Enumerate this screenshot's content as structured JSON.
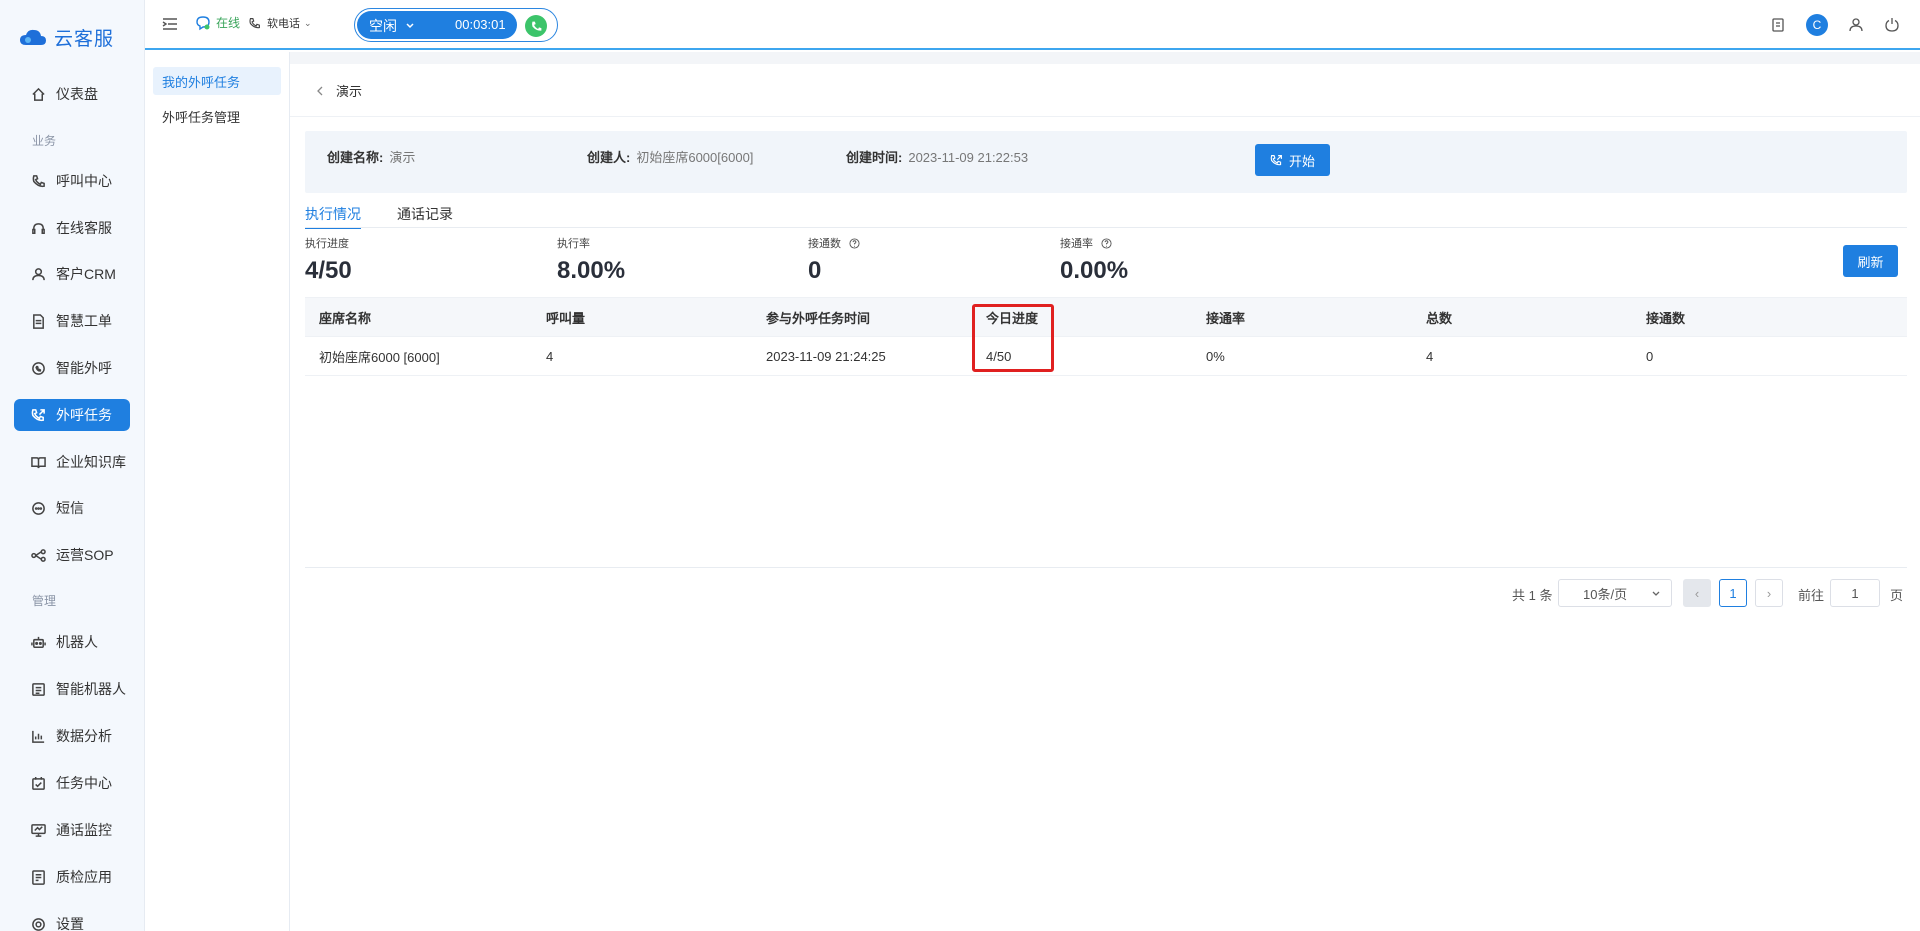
{
  "app": {
    "logo_text": "云客服"
  },
  "sidebar": {
    "items": [
      {
        "label": "仪表盘",
        "icon": "home-icon"
      },
      {
        "label": "呼叫中心",
        "icon": "phone-icon"
      },
      {
        "label": "在线客服",
        "icon": "headset-icon"
      },
      {
        "label": "客户CRM",
        "icon": "user-icon"
      },
      {
        "label": "智慧工单",
        "icon": "document-icon"
      },
      {
        "label": "智能外呼",
        "icon": "chat-phone-icon"
      },
      {
        "label": "外呼任务",
        "icon": "outbound-call-icon"
      },
      {
        "label": "企业知识库",
        "icon": "book-icon"
      },
      {
        "label": "短信",
        "icon": "message-icon"
      },
      {
        "label": "运营SOP",
        "icon": "flow-icon"
      },
      {
        "label": "机器人",
        "icon": "robot-icon"
      },
      {
        "label": "智能机器人",
        "icon": "smart-robot-icon"
      },
      {
        "label": "数据分析",
        "icon": "chart-icon"
      },
      {
        "label": "任务中心",
        "icon": "task-icon"
      },
      {
        "label": "通话监控",
        "icon": "monitor-icon"
      },
      {
        "label": "质检应用",
        "icon": "inspect-icon"
      },
      {
        "label": "设置",
        "icon": "gear-icon"
      }
    ],
    "sections": {
      "business": "业务",
      "manage": "管理"
    }
  },
  "topbar": {
    "online_status": "在线",
    "softphone_label": "软电话",
    "call_state": "空闲",
    "call_timer": "00:03:01",
    "avatar_letter": "C"
  },
  "submenu": {
    "items": [
      {
        "label": "我的外呼任务"
      },
      {
        "label": "外呼任务管理"
      }
    ]
  },
  "detail": {
    "back_title": "演示",
    "info": {
      "name_key": "创建名称:",
      "name_val": "演示",
      "creator_key": "创建人:",
      "creator_val": "初始座席6000[6000]",
      "time_key": "创建时间:",
      "time_val": "2023-11-09 21:22:53"
    },
    "start_label": "开始",
    "tabs": [
      "执行情况",
      "通话记录"
    ],
    "stats": [
      {
        "label": "执行进度",
        "value": "4/50"
      },
      {
        "label": "执行率",
        "value": "8.00%"
      },
      {
        "label": "接通数",
        "value": "0"
      },
      {
        "label": "接通率",
        "value": "0.00%"
      }
    ],
    "refresh_label": "刷新"
  },
  "table": {
    "columns": [
      "座席名称",
      "呼叫量",
      "参与外呼任务时间",
      "今日进度",
      "接通率",
      "总数",
      "接通数"
    ],
    "rows": [
      [
        "初始座席6000 [6000]",
        "4",
        "2023-11-09 21:24:25",
        "4/50",
        "0%",
        "4",
        "0"
      ]
    ]
  },
  "pager": {
    "total": "共 1 条",
    "page_size": "10条/页",
    "current": "1",
    "goto_label": "前往",
    "goto_value": "1",
    "page_suffix": "页"
  },
  "colors": {
    "accent": "#1f7fe0",
    "online": "#3aa55b",
    "highlight": "#e02020"
  }
}
